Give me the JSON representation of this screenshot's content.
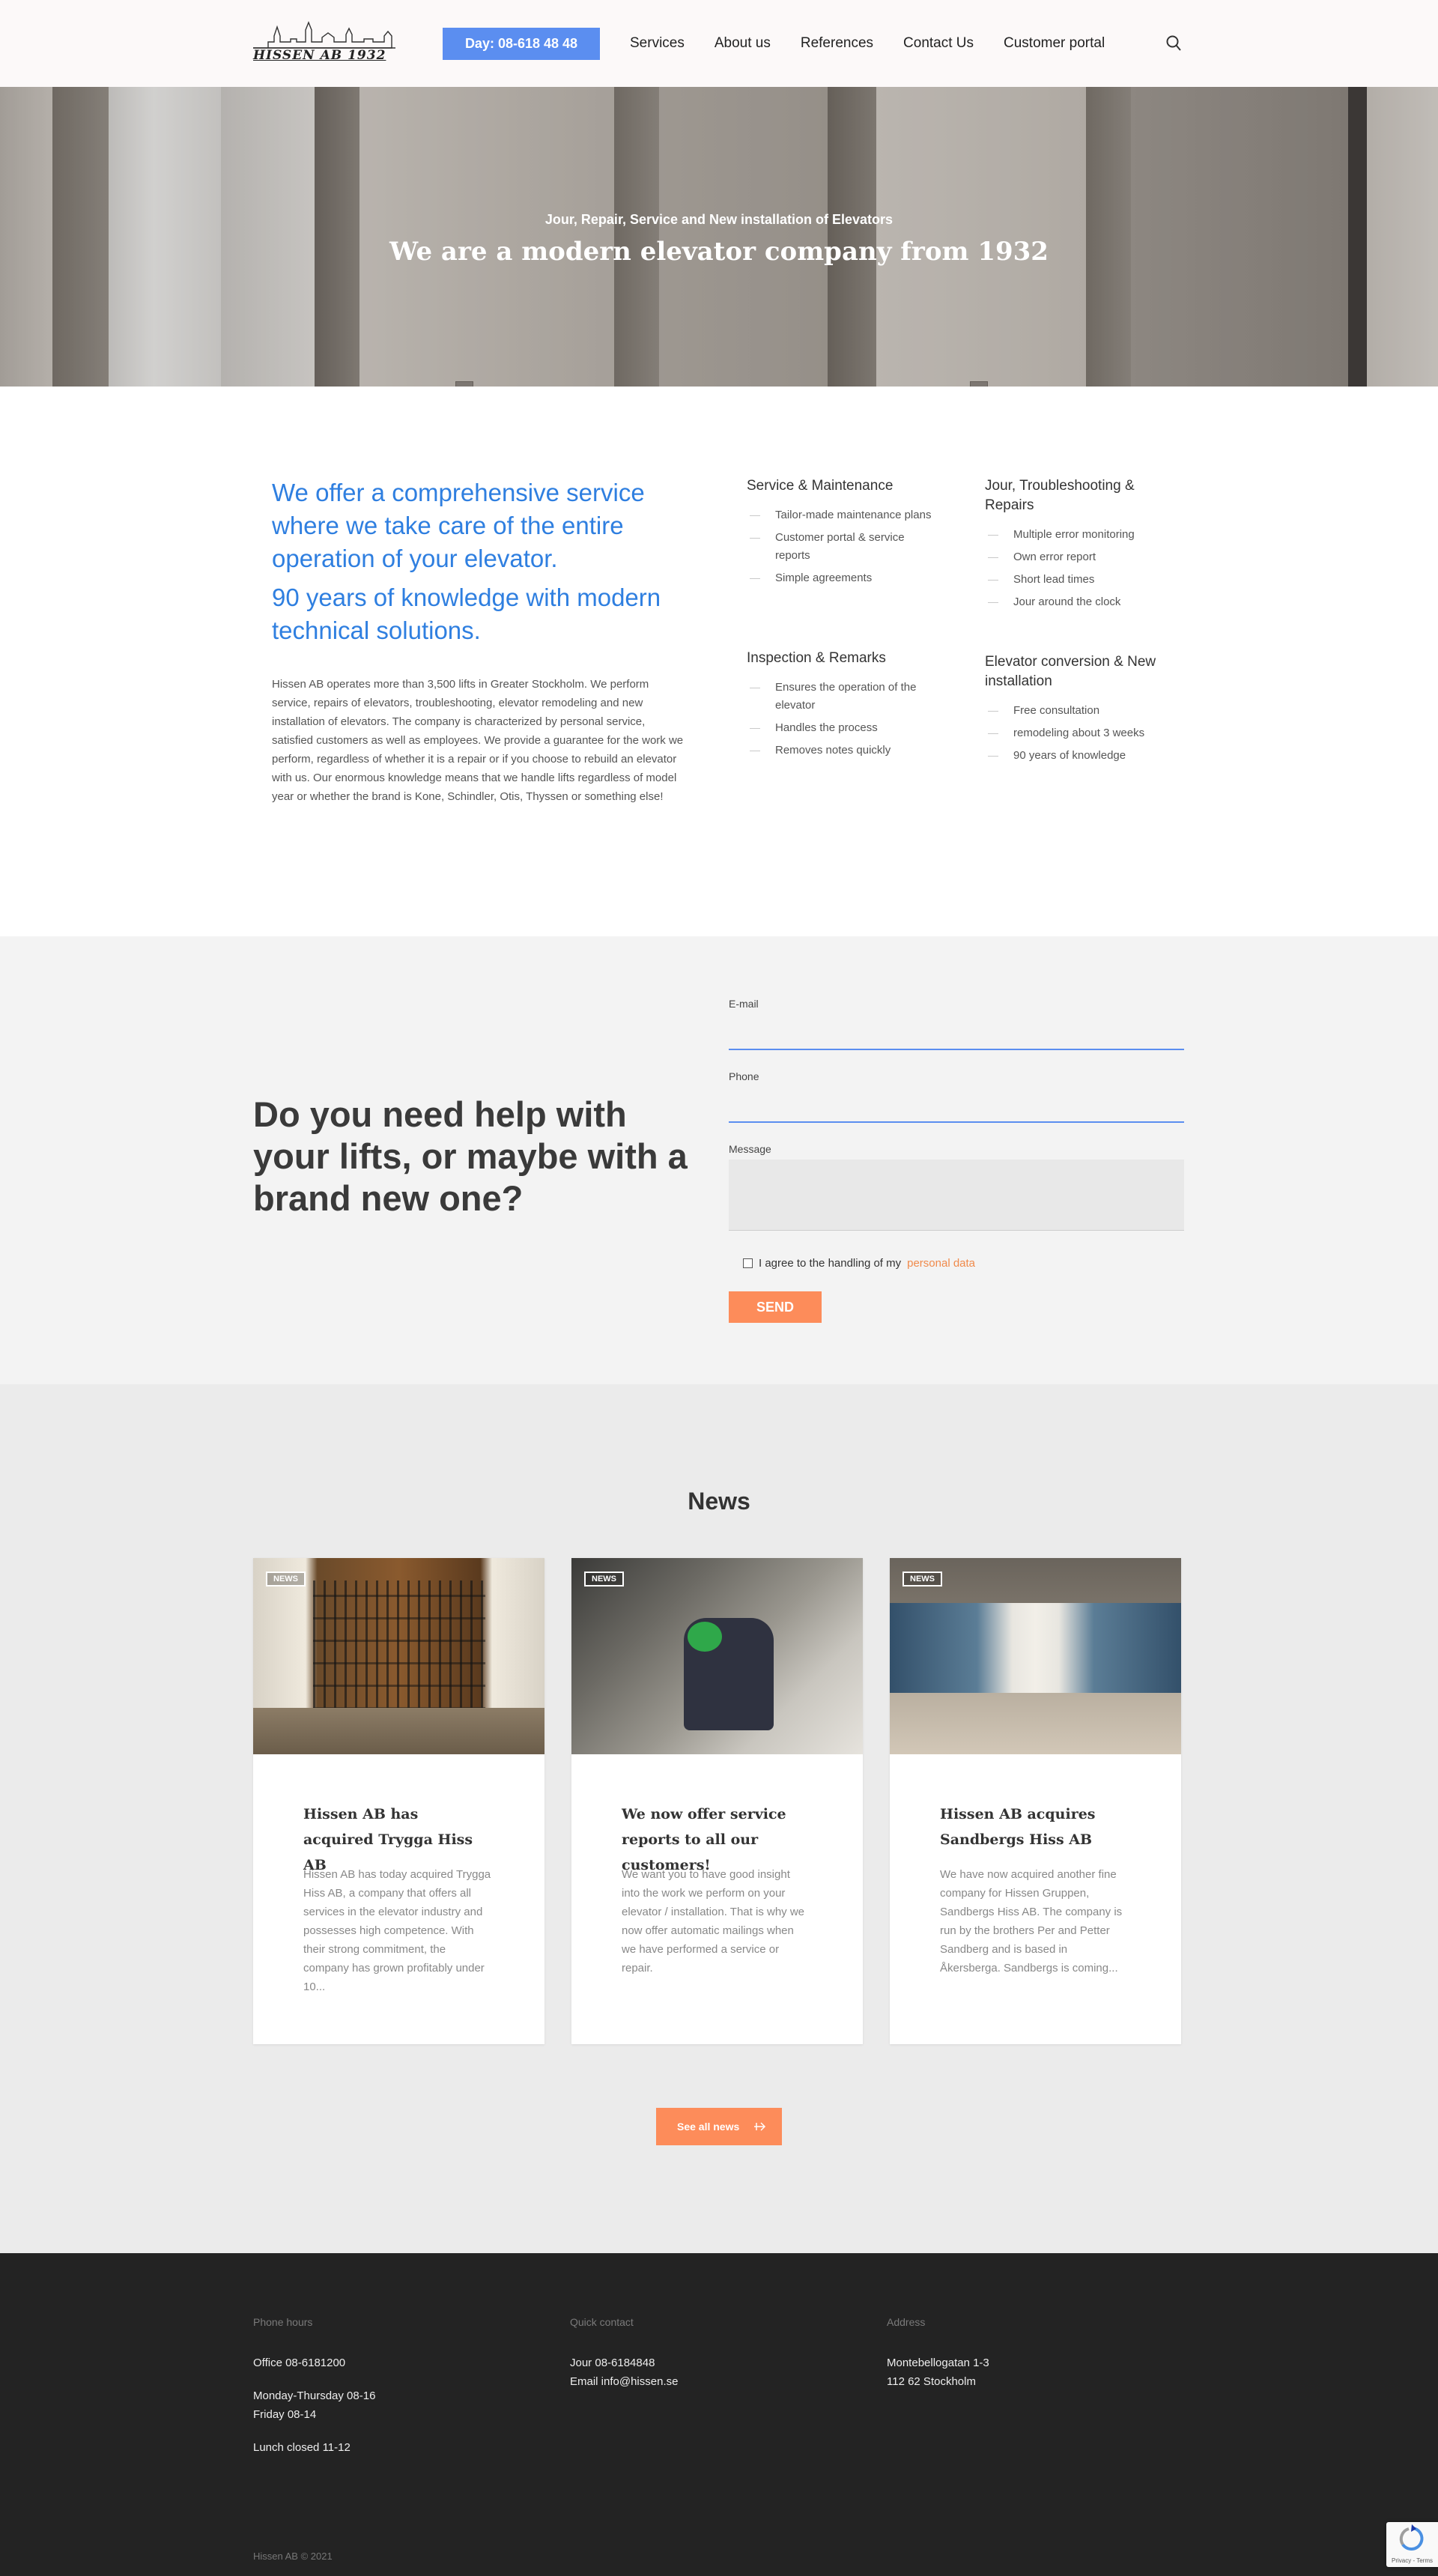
{
  "header": {
    "logo_text": "HISSEN AB 1932",
    "phone_button": "Day: 08-618 48 48",
    "nav": [
      "Services",
      "About us",
      "References",
      "Contact Us",
      "Customer portal"
    ]
  },
  "hero": {
    "subtitle": "Jour, Repair, Service and New installation of Elevators",
    "title": "We are a modern elevator company from 1932"
  },
  "services": {
    "lead_1": "We offer a comprehensive service where we take care of the entire operation of your elevator.",
    "lead_2": "90 years of knowledge with modern technical solutions.",
    "intro": "Hissen AB operates more than 3,500 lifts in Greater Stockholm. We perform service, repairs of elevators, troubleshooting, elevator remodeling and new installation of elevators. The company is characterized by personal service, satisfied customers as well as employees. We provide a guarantee for the work we perform, regardless of whether it is a repair or if you choose to rebuild an elevator with us. Our enormous knowledge means that we handle lifts regardless of model year or whether the brand is Kone, Schindler, Otis, Thyssen or something else!",
    "blocks": [
      {
        "title": "Service & Maintenance",
        "items": [
          "Tailor-made maintenance plans",
          "Customer portal & service reports",
          "Simple agreements"
        ]
      },
      {
        "title": "Jour, Troubleshooting & Repairs",
        "items": [
          "Multiple error monitoring",
          "Own error report",
          "Short lead times",
          "Jour around the clock"
        ]
      },
      {
        "title": "Inspection & Remarks",
        "items": [
          "Ensures the operation of the elevator",
          "Handles the process",
          "Removes notes quickly"
        ]
      },
      {
        "title": "Elevator conversion & New installation",
        "items": [
          "Free consultation",
          "remodeling about 3 weeks",
          "90 years of knowledge"
        ]
      }
    ]
  },
  "contact": {
    "heading": "Do you need help with your lifts, or maybe with a brand new one?",
    "email_label": "E-mail",
    "phone_label": "Phone",
    "message_label": "Message",
    "consent_text": "I agree to the handling of my",
    "consent_link": "personal data",
    "send_label": "SEND"
  },
  "news": {
    "title": "News",
    "tag": "NEWS",
    "cards": [
      {
        "title": "Hissen AB has acquired Trygga Hiss AB",
        "text": "Hissen AB has today acquired Trygga Hiss AB, a company that offers all services in the elevator industry and possesses high competence. With their strong commitment, the company has grown profitably under 10..."
      },
      {
        "title": "We now offer service reports to all our customers!",
        "text": "We want you to have good insight into the work we perform on your elevator / installation. That is why we now offer automatic mailings when we have performed a service or repair."
      },
      {
        "title": "Hissen AB acquires Sandbergs Hiss AB",
        "text": "We have now acquired another fine company for Hissen Gruppen, Sandbergs Hiss AB. The company is run by the brothers Per and Petter Sandberg and is based in Åkersberga. Sandbergs is coming..."
      }
    ],
    "all_button": "See all news"
  },
  "footer": {
    "phone_hours_heading": "Phone hours",
    "office": "Office 08-6181200",
    "hours_1": "Monday-Thursday 08-16",
    "hours_2": "Friday 08-14",
    "lunch": "Lunch closed 11-12",
    "quick_heading": "Quick contact",
    "jour": "Jour 08-6184848",
    "email": "Email info@hissen.se",
    "address_heading": "Address",
    "street": "Montebellogatan 1-3",
    "city": "112 62 Stockholm",
    "copyright": "Hissen AB © 2021",
    "recaptcha_text": "Privacy - Terms"
  },
  "colors": {
    "accent_blue": "#5b8ef0",
    "heading_blue": "#2f7fe0",
    "orange": "#fd8c5a",
    "footer_bg": "#232323"
  }
}
